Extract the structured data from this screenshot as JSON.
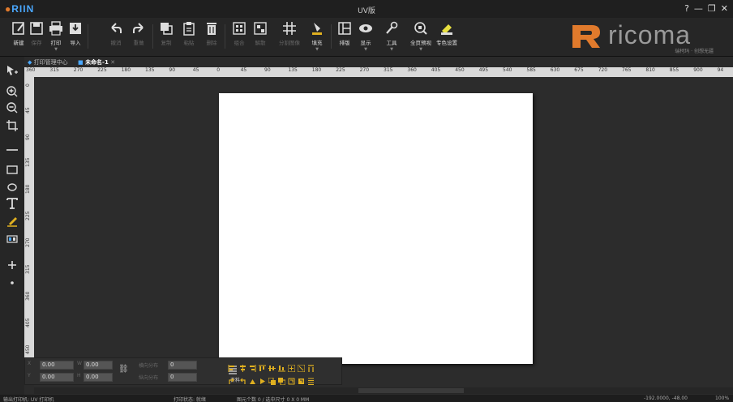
{
  "window": {
    "app_logo": "RIIN",
    "title": "UV版",
    "controls": [
      "?",
      "—",
      "❐",
      "✕"
    ]
  },
  "ribbon": {
    "tools": [
      {
        "id": "new",
        "label": "新建",
        "icon": "new-file-icon",
        "enabled": true
      },
      {
        "id": "save",
        "label": "保存",
        "icon": "save-icon",
        "enabled": false
      },
      {
        "id": "print",
        "label": "打印",
        "icon": "printer-icon",
        "enabled": true
      },
      {
        "id": "import",
        "label": "导入",
        "icon": "import-icon",
        "enabled": true
      },
      {
        "id": "undo",
        "label": "撤消",
        "icon": "undo-icon",
        "enabled": false
      },
      {
        "id": "redo",
        "label": "重做",
        "icon": "redo-icon",
        "enabled": false
      },
      {
        "id": "copy",
        "label": "复制",
        "icon": "copy-icon",
        "enabled": false
      },
      {
        "id": "paste",
        "label": "粘贴",
        "icon": "paste-icon",
        "enabled": false
      },
      {
        "id": "delete",
        "label": "删除",
        "icon": "trash-icon",
        "enabled": false
      },
      {
        "id": "group",
        "label": "组合",
        "icon": "group-icon",
        "enabled": false
      },
      {
        "id": "ungroup",
        "label": "解散",
        "icon": "ungroup-icon",
        "enabled": false
      },
      {
        "id": "split",
        "label": "分割图像",
        "icon": "grid-icon",
        "enabled": false
      },
      {
        "id": "fill",
        "label": "填充",
        "icon": "fill-icon",
        "enabled": true
      },
      {
        "id": "layout",
        "label": "排版",
        "icon": "layout-icon",
        "enabled": true
      },
      {
        "id": "display",
        "label": "显示",
        "icon": "eye-icon",
        "enabled": true
      },
      {
        "id": "tools",
        "label": "工具",
        "icon": "wrench-icon",
        "enabled": true
      },
      {
        "id": "preview",
        "label": "全页预视",
        "icon": "zoom-preview-icon",
        "enabled": true
      },
      {
        "id": "spot",
        "label": "专色设置",
        "icon": "spot-color-icon",
        "enabled": true
      }
    ]
  },
  "brand": {
    "name": "ricoma",
    "slogan": "瑞柯玛 · 创想无疆"
  },
  "tabs": [
    {
      "label": "打印管理中心",
      "active": false
    },
    {
      "label": "未命名-1",
      "active": true
    }
  ],
  "ruler": {
    "h_ticks": [
      "360",
      "315",
      "270",
      "225",
      "180",
      "135",
      "90",
      "45",
      "0",
      "45",
      "90",
      "135",
      "180",
      "225",
      "270",
      "315",
      "360",
      "405",
      "450",
      "495",
      "540",
      "585",
      "630",
      "675",
      "720",
      "765",
      "810",
      "855",
      "900",
      "94"
    ],
    "v_ticks": [
      "0",
      "45",
      "90",
      "135",
      "180",
      "225",
      "270",
      "315",
      "360",
      "405",
      "450"
    ]
  },
  "props": {
    "x_label": "X",
    "x_value": "0.00",
    "w_label": "W",
    "w_value": "0.00",
    "y_label": "Y",
    "y_value": "0.00",
    "h_label": "H",
    "h_value": "0.00",
    "hdist_label": "横向分布",
    "hdist_value": "0",
    "vdist_label": "纵向分布",
    "vdist_value": "0",
    "align_label": "齐料"
  },
  "status": {
    "left": "输出打印机: UV 打印机",
    "state": "打印状态: 就绪",
    "info": "图元个数 0 / 选中尺寸 0 X 0 MM",
    "coords": "-192.0000, -48.00",
    "zoom": "100%"
  },
  "colors": {
    "accent": "#e07a2c",
    "brand_gray": "#9a9a9a",
    "canvas": "#2c2c2c",
    "page": "#ffffff"
  }
}
